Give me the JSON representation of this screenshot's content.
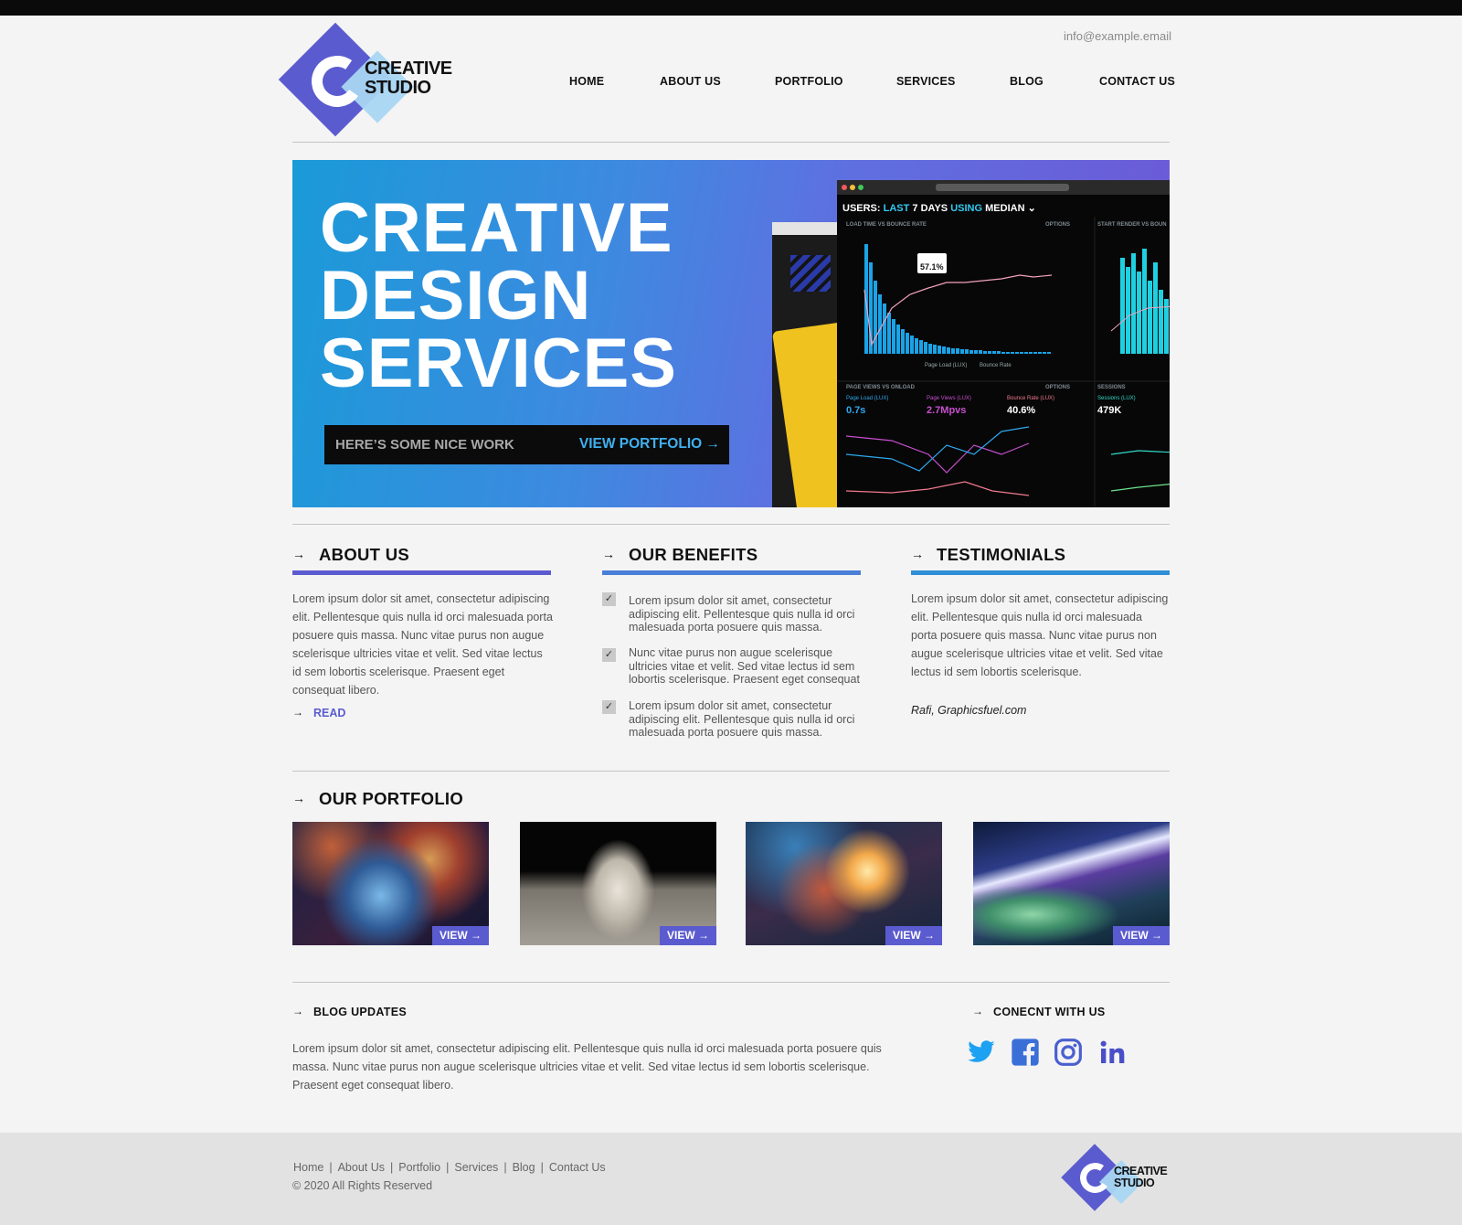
{
  "header": {
    "logo_line1": "CREATIVE",
    "logo_line2": "STUDIO",
    "email": "info@example.email",
    "nav": [
      "HOME",
      "ABOUT US",
      "PORTFOLIO",
      "SERVICES",
      "BLOG",
      "CONTACT US"
    ]
  },
  "hero": {
    "title_lines": [
      "CREATIVE",
      "DESIGN",
      "SERVICES"
    ],
    "cta_text": "HERE’S SOME NICE WORK",
    "cta_link": "VIEW PORTFOLIO →",
    "dashboard": {
      "title_prefix": "USERS:",
      "title_mid": "LAST",
      "title_days": "7 DAYS",
      "title_using": "USING",
      "title_end": "MEDIAN",
      "panel1": "LOAD TIME VS BOUNCE RATE",
      "panel2": "START RENDER VS BOUN",
      "panel3": "PAGE VIEWS VS ONLOAD",
      "panel4": "SESSIONS",
      "options": "OPTIONS",
      "tooltip_value": "57.1%",
      "legend_a": "Page Load (LUX)",
      "legend_b": "Bounce Rate",
      "kpis": [
        {
          "label": "Page Load (LUX)",
          "value": "0.7s",
          "color": "#2ea8ef"
        },
        {
          "label": "Page Views (LUX)",
          "value": "2.7Mpvs",
          "color": "#c84fd0"
        },
        {
          "label": "Bounce Rate (LUX)",
          "value": "40.6%",
          "color": "#f07a8f"
        },
        {
          "label": "Sessions (LUX)",
          "value": "479K",
          "color": "#33d9c9"
        }
      ]
    }
  },
  "about": {
    "heading": "ABOUT US",
    "text": "Lorem ipsum dolor sit amet, consectetur adipiscing elit. Pellentesque quis nulla id orci malesuada porta posuere quis massa. Nunc vitae purus non augue scelerisque ultricies vitae et velit. Sed vitae lectus id sem lobortis scelerisque. Praesent eget consequat libero.",
    "read": "READ"
  },
  "benefits": {
    "heading": "OUR BENEFITS",
    "items": [
      "Lorem ipsum dolor sit amet, consectetur adipiscing elit. Pellentesque quis nulla id orci malesuada porta posuere quis massa.",
      "Nunc vitae purus non augue scelerisque ultricies vitae et velit. Sed vitae lectus id sem lobortis scelerisque. Praesent eget consequat",
      "Lorem ipsum dolor sit amet, consectetur adipiscing elit. Pellentesque quis nulla id orci malesuada porta posuere quis massa."
    ]
  },
  "testimonials": {
    "heading": "TESTIMONIALS",
    "text": "Lorem ipsum dolor sit amet, consectetur adipiscing elit. Pellentesque quis nulla id orci malesuada porta posuere quis massa. Nunc vitae purus non augue scelerisque ultricies vitae et velit. Sed vitae lectus id sem lobortis scelerisque.",
    "author": "Rafi, Graphicsfuel.com"
  },
  "portfolio": {
    "heading": "OUR PORTFOLIO",
    "view_label": "VIEW →",
    "items": [
      "bubble-nebula-image",
      "astronaut-on-moon-image",
      "milky-way-image",
      "earth-aurora-from-space-image"
    ]
  },
  "blog": {
    "heading": "BLOG UPDATES",
    "text": "Lorem ipsum dolor sit amet, consectetur adipiscing elit. Pellentesque quis nulla id orci malesuada porta posuere quis massa. Nunc vitae purus non augue scelerisque ultricies vitae et velit. Sed vitae lectus id sem lobortis scelerisque. Praesent eget consequat libero."
  },
  "connect": {
    "heading": "CONECNT WITH US",
    "icons": [
      "twitter-icon",
      "facebook-icon",
      "instagram-icon",
      "linkedin-icon"
    ]
  },
  "footer": {
    "links": [
      "Home",
      "About Us",
      "Portfolio",
      "Services",
      "Blog",
      "Contact Us"
    ],
    "separator": "|",
    "copyright": "© 2020 All Rights Reserved"
  },
  "colors": {
    "accent": "#5b5bd0",
    "accent_light": "#a9d6f2",
    "bar_about": "#5b5bd0",
    "bar_benefits": "#4a7fd8",
    "bar_testimonials": "#2f8ed6",
    "twitter": "#1da1f2",
    "facebook": "#3b6fd8",
    "instagram": "#4a5fd0",
    "linkedin": "#4a4fc8"
  }
}
